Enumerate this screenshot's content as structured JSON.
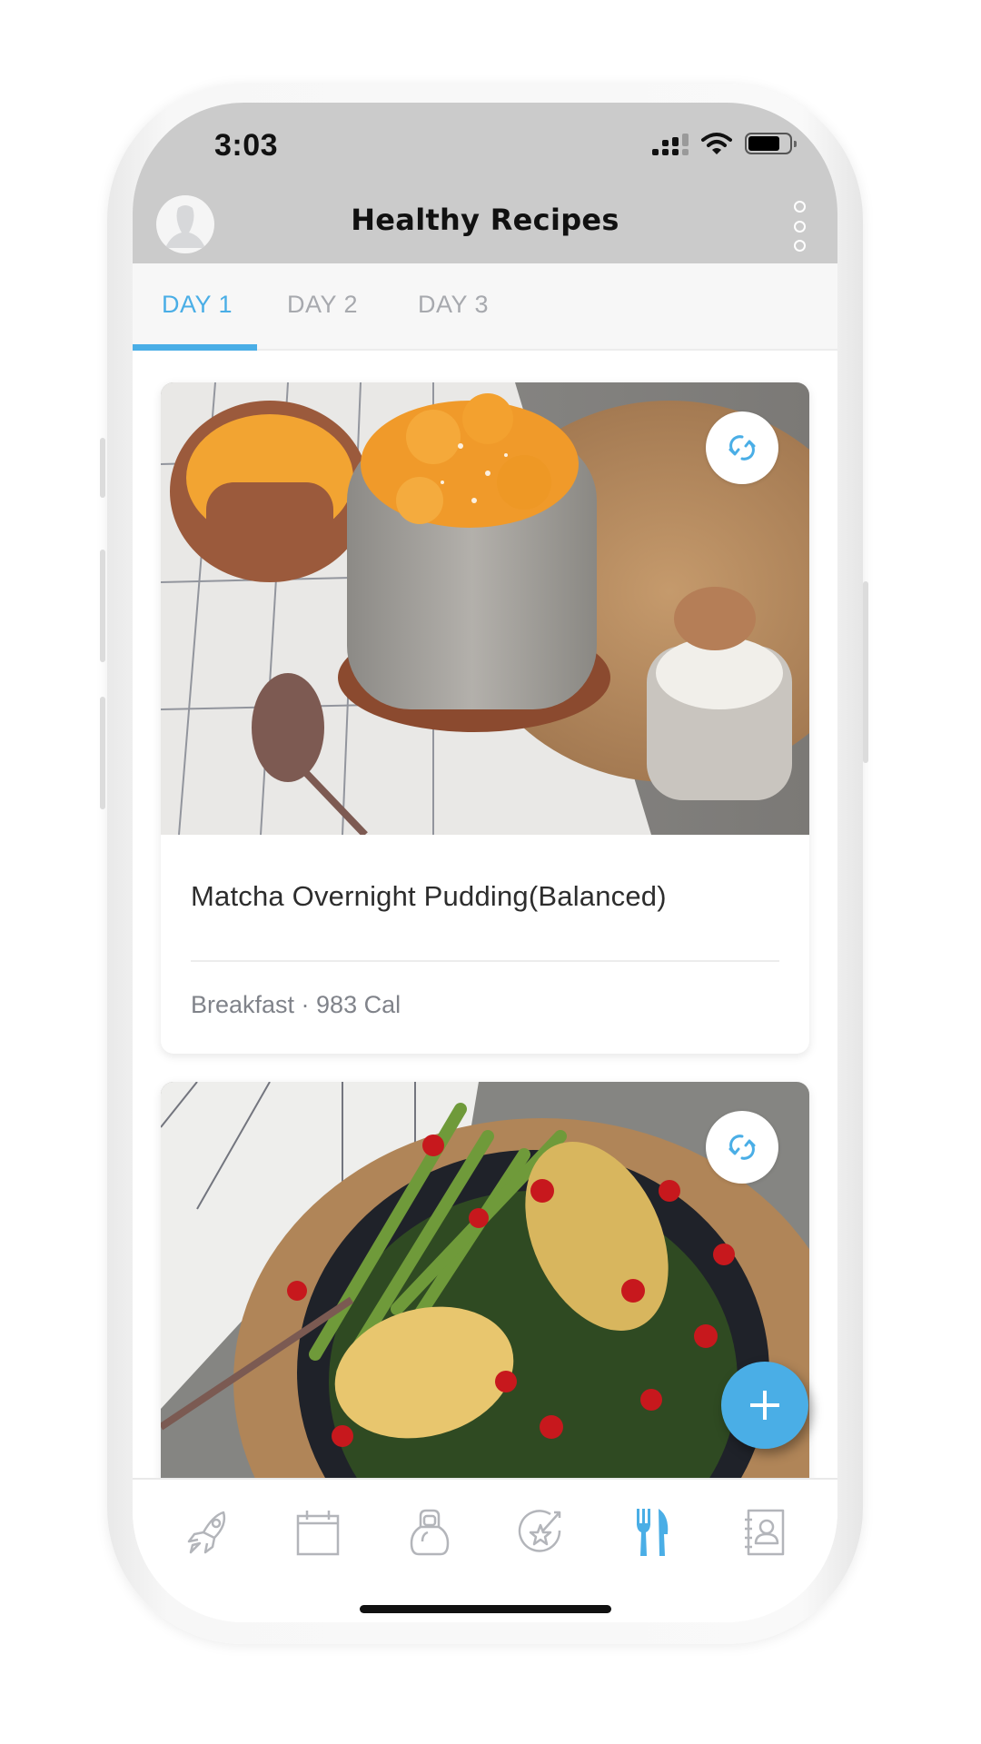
{
  "status_bar": {
    "time": "3:03",
    "icons": [
      "cellular-signal-icon",
      "wifi-icon",
      "battery-icon"
    ]
  },
  "header": {
    "title": "Healthy Recipes",
    "avatar_icon": "user-avatar-icon",
    "menu_icon": "more-vertical-icon"
  },
  "tabs": [
    {
      "label": "DAY 1",
      "active": true
    },
    {
      "label": "DAY 2",
      "active": false
    },
    {
      "label": "DAY 3",
      "active": false
    }
  ],
  "recipes": [
    {
      "title": "Matcha Overnight Pudding(Balanced)",
      "meta": "Breakfast · 983 Cal",
      "image": "matcha-pudding-with-mango-photo",
      "action_icon": "swap-refresh-icon"
    },
    {
      "title": "",
      "meta": "",
      "image": "chicken-asparagus-potato-plate-photo",
      "action_icon": "swap-refresh-icon"
    }
  ],
  "fab": {
    "icon": "plus-icon"
  },
  "bottom_nav": [
    {
      "name": "rocket",
      "icon": "rocket-icon",
      "active": false
    },
    {
      "name": "calendar",
      "icon": "calendar-icon",
      "active": false
    },
    {
      "name": "workout",
      "icon": "kettlebell-icon",
      "active": false
    },
    {
      "name": "goals",
      "icon": "star-target-icon",
      "active": false
    },
    {
      "name": "recipes",
      "icon": "fork-knife-icon",
      "active": true
    },
    {
      "name": "contacts",
      "icon": "contact-book-icon",
      "active": false
    }
  ],
  "colors": {
    "accent": "#4aaee6",
    "header_bg": "#cbcbcb",
    "tab_bg": "#f7f7f7",
    "inactive": "#a7a9ae"
  }
}
